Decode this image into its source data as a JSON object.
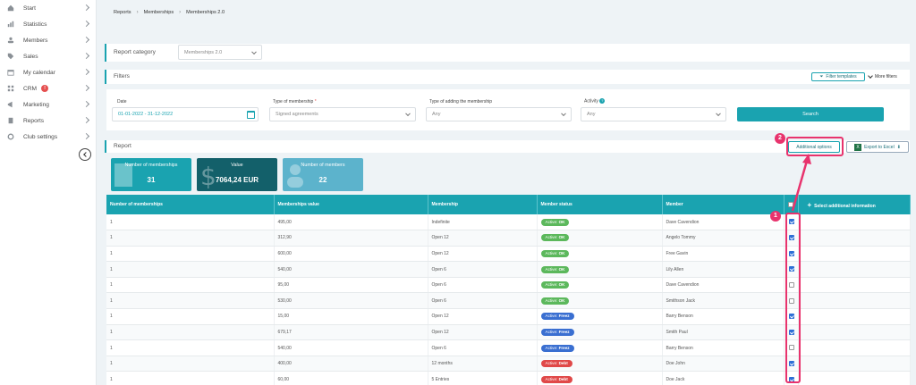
{
  "sidebar": {
    "items": [
      {
        "label": "Start",
        "icon": "home-icon"
      },
      {
        "label": "Statistics",
        "icon": "stats-icon"
      },
      {
        "label": "Members",
        "icon": "user-icon"
      },
      {
        "label": "Sales",
        "icon": "tag-icon"
      },
      {
        "label": "My calendar",
        "icon": "calendar-icon"
      },
      {
        "label": "CRM",
        "icon": "crm-icon",
        "badge": "!"
      },
      {
        "label": "Marketing",
        "icon": "megaphone-icon"
      },
      {
        "label": "Reports",
        "icon": "report-icon"
      },
      {
        "label": "Club settings",
        "icon": "gear-icon"
      }
    ]
  },
  "breadcrumb": [
    "Reports",
    "Memberships",
    "Memberships 2.0"
  ],
  "report_category": {
    "label": "Report category",
    "value": "Memberships 2.0"
  },
  "filters": {
    "title": "Filters",
    "filter_templates": "Filter templates",
    "more_filters": "More filters",
    "date_label": "Date",
    "date_value": "01-01-2022 - 31-12-2022",
    "type_label": "Type of membership",
    "type_required": "*",
    "type_value": "Signed agreements",
    "adding_label": "Type of adding the membership",
    "adding_value": "Any",
    "activity_label": "Activity",
    "activity_value": "Any",
    "search_button": "Search"
  },
  "report": {
    "title": "Report",
    "additional_options": "Additional options",
    "export_excel": "Export to Excel",
    "cards": [
      {
        "label": "Number of memberships",
        "value": "31",
        "color": "#1aa3b0"
      },
      {
        "label": "Value",
        "value": "7064,24 EUR",
        "color": "#13606a"
      },
      {
        "label": "Number of members",
        "value": "22",
        "color": "#5cb3cc"
      }
    ]
  },
  "table": {
    "headers": [
      "Number of memberships",
      "Memberships value",
      "Membership",
      "Member status",
      "Member",
      "",
      "Select additional information"
    ],
    "rows": [
      {
        "n": "1",
        "value": "495,00",
        "membership": "Indefinite",
        "status_prefix": "Active: ",
        "status": "OK",
        "member": "Dave Cavendion",
        "checked": true
      },
      {
        "n": "1",
        "value": "312,90",
        "membership": "Open 12",
        "status_prefix": "Active: ",
        "status": "OK",
        "member": "Angelo Tommy",
        "checked": true
      },
      {
        "n": "1",
        "value": "600,00",
        "membership": "Open 12",
        "status_prefix": "Active: ",
        "status": "OK",
        "member": "Free Gavin",
        "checked": true
      },
      {
        "n": "1",
        "value": "540,00",
        "membership": "Open 6",
        "status_prefix": "Active: ",
        "status": "OK",
        "member": "Lily Allen",
        "checked": true
      },
      {
        "n": "1",
        "value": "95,00",
        "membership": "Open 6",
        "status_prefix": "Active: ",
        "status": "OK",
        "member": "Dave Cavendion",
        "checked": false
      },
      {
        "n": "1",
        "value": "530,00",
        "membership": "Open 6",
        "status_prefix": "Active: ",
        "status": "OK",
        "member": "Smithson Jack",
        "checked": false
      },
      {
        "n": "1",
        "value": "15,00",
        "membership": "Open 12",
        "status_prefix": "Active: ",
        "status": "Freez",
        "member": "Barry Benson",
        "checked": true
      },
      {
        "n": "1",
        "value": "679,17",
        "membership": "Open 12",
        "status_prefix": "Active: ",
        "status": "Freez",
        "member": "Smith Paul",
        "checked": true
      },
      {
        "n": "1",
        "value": "540,00",
        "membership": "Open 6",
        "status_prefix": "Active: ",
        "status": "Freez",
        "member": "Barry Benson",
        "checked": false
      },
      {
        "n": "1",
        "value": "400,00",
        "membership": "12 months",
        "status_prefix": "Active: ",
        "status": "Debt",
        "member": "Doe John",
        "checked": true
      },
      {
        "n": "1",
        "value": "60,00",
        "membership": "5 Entries",
        "status_prefix": "Active: ",
        "status": "Debt",
        "member": "Doe Jack",
        "checked": true
      }
    ]
  },
  "status_colors": {
    "OK": "#5cb85c",
    "Freez": "#3a6fd1",
    "Debt": "#e04848"
  },
  "annotations": {
    "badge1": "1",
    "badge2": "2",
    "color": "#e8336d"
  }
}
